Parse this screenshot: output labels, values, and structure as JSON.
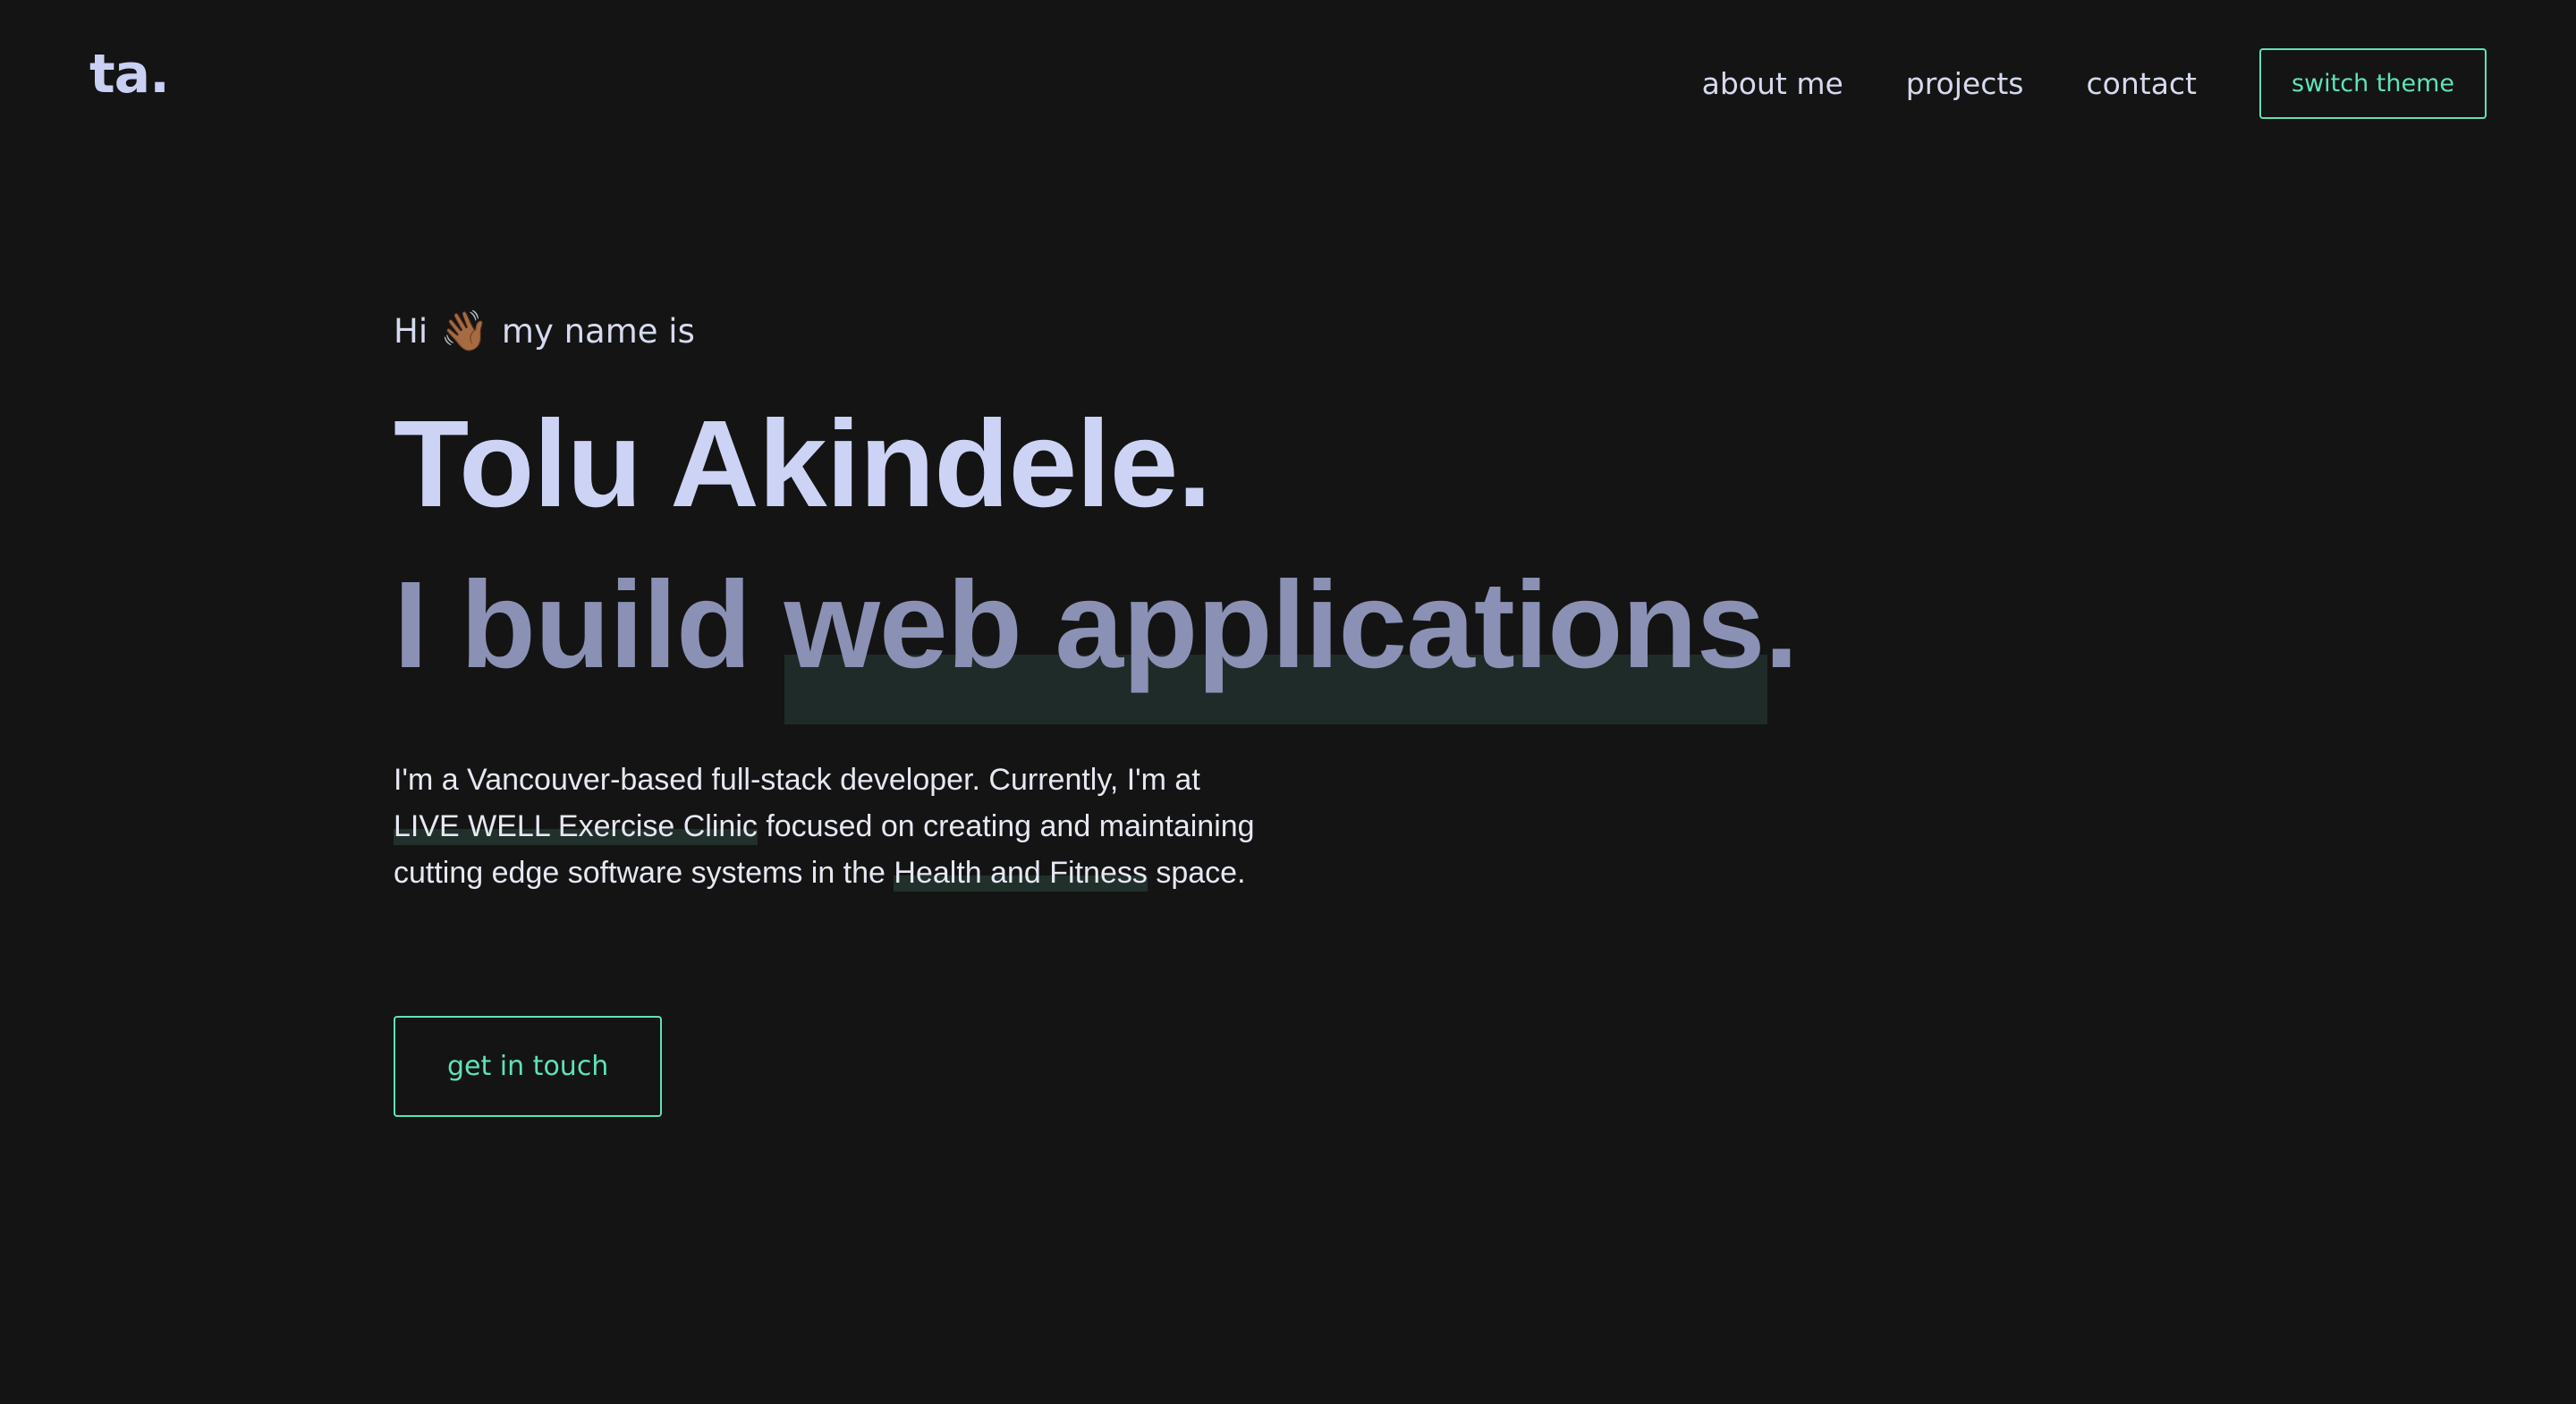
{
  "brand": {
    "logo": "ta."
  },
  "nav": {
    "links": [
      "about me",
      "projects",
      "contact"
    ],
    "theme_button": "switch theme"
  },
  "hero": {
    "greeting_before": "Hi",
    "wave_emoji": "👋🏾",
    "greeting_after": "my name is",
    "name": "Tolu Akindele.",
    "tagline_prefix": "I build ",
    "tagline_highlight": "web applications.",
    "intro": {
      "part1": "I'm a Vancouver-based full-stack developer. Currently, I'm at",
      "link1": "LIVE WELL Exercise Clinic",
      "part2": " focused on creating and maintaining cutting edge software systems in the ",
      "link2": "Health and Fitness",
      "part3": " space."
    },
    "cta_label": "get in touch"
  },
  "colors": {
    "background": "#141414",
    "accent": "#5fe3b4",
    "name_color": "#ccd3f5",
    "tagline_color": "#8a91b4",
    "highlight_bg": "#1f2b28"
  }
}
